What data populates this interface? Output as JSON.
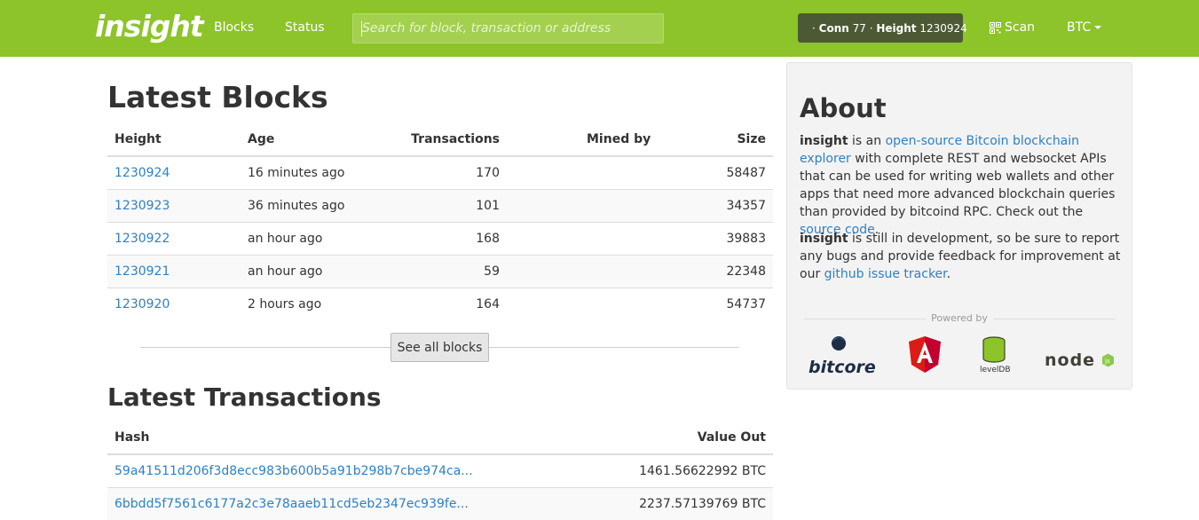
{
  "nav": {
    "brand": "insight",
    "links": [
      "Blocks",
      "Status"
    ],
    "search_placeholder": "Search for block, transaction or address",
    "status": {
      "conn_label": "Conn",
      "conn_value": "77",
      "height_label": "Height",
      "height_value": "1230924"
    },
    "scan_label": "Scan",
    "currency": "BTC"
  },
  "blocks": {
    "title": "Latest Blocks",
    "headers": [
      "Height",
      "Age",
      "Transactions",
      "Mined by",
      "Size"
    ],
    "rows": [
      {
        "height": "1230924",
        "age": "16 minutes ago",
        "transactions": "170",
        "mined_by": "",
        "size": "58487"
      },
      {
        "height": "1230923",
        "age": "36 minutes ago",
        "transactions": "101",
        "mined_by": "",
        "size": "34357"
      },
      {
        "height": "1230922",
        "age": "an hour ago",
        "transactions": "168",
        "mined_by": "",
        "size": "39883"
      },
      {
        "height": "1230921",
        "age": "an hour ago",
        "transactions": "59",
        "mined_by": "",
        "size": "22348"
      },
      {
        "height": "1230920",
        "age": "2 hours ago",
        "transactions": "164",
        "mined_by": "",
        "size": "54737"
      }
    ],
    "see_all_label": "See all blocks"
  },
  "transactions": {
    "title": "Latest Transactions",
    "headers": [
      "Hash",
      "Value Out"
    ],
    "rows": [
      {
        "hash": "59a41511d206f3d8ecc983b600b5a91b298b7cbe974ca...",
        "value": "1461.56622992 BTC"
      },
      {
        "hash": "6bbdd5f7561c6177a2c3e78aaeb11cd5eb2347ec939fe...",
        "value": "2237.57139769 BTC"
      }
    ]
  },
  "about": {
    "title": "About",
    "p1_strong": "insight",
    "p1_text1": " is an ",
    "p1_link1": "open-source Bitcoin blockchain explorer",
    "p1_text2": " with complete REST and websocket APIs that can be used for writing web wallets and other apps that need more advanced blockchain queries than provided by bitcoind RPC. Check out the ",
    "p1_link2": "source code",
    "p1_text3": ".",
    "p2_strong": "insight",
    "p2_text1": " is still in development, so be sure to report any bugs and provide feedback for improvement at our ",
    "p2_link": "github issue tracker",
    "p2_text2": ".",
    "powered_by": "Powered by",
    "logos": {
      "bitcore": "bitcore",
      "leveldb": "levelDB",
      "node": "node"
    }
  },
  "colors": {
    "navbar": "#8dc429",
    "link": "#2e80c4",
    "badge": "#4b5a34"
  }
}
